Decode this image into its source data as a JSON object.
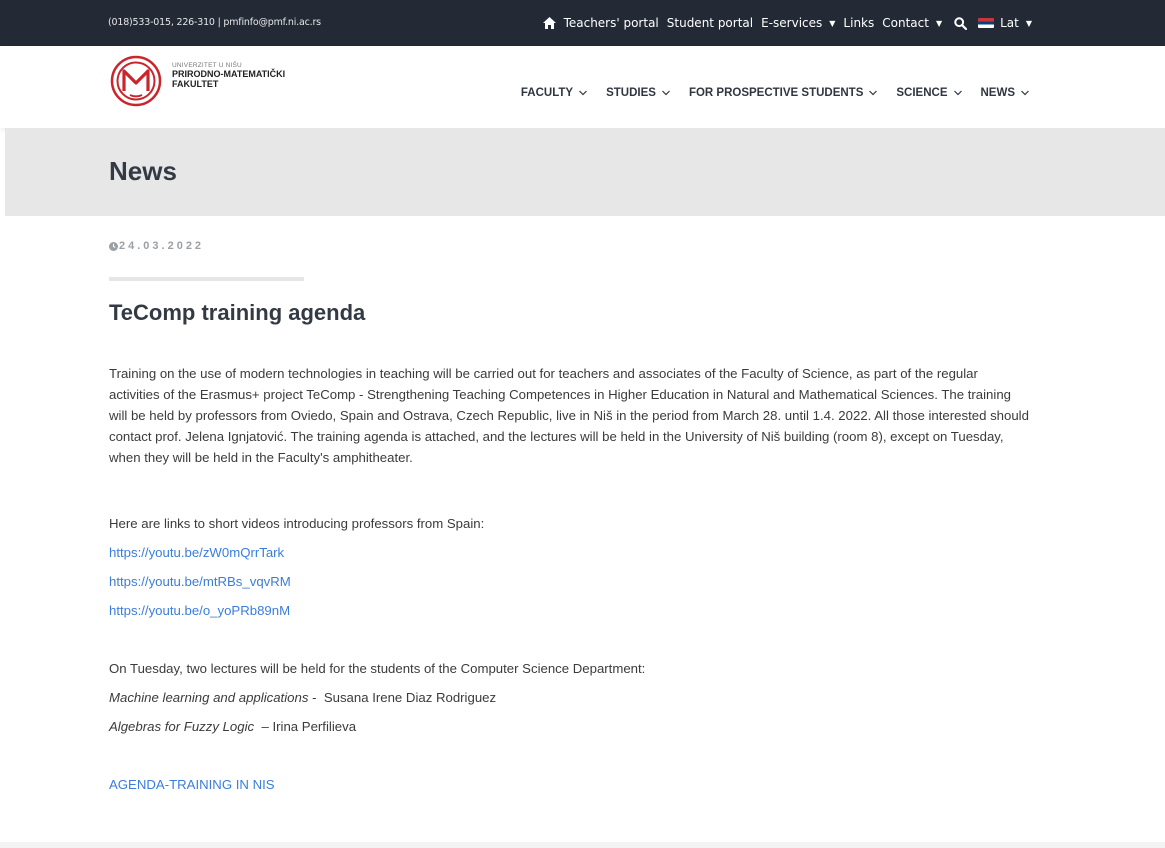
{
  "topbar": {
    "contact": "(018)533-015, 226-310 | pmfinfo@pmf.ni.ac.rs",
    "nav": {
      "teachers_portal": "Teachers' portal",
      "student_portal": "Student portal",
      "e_services": "E-services",
      "links": "Links",
      "contact": "Contact",
      "language": "Lat"
    }
  },
  "logo": {
    "line1": "UNIVERZITET U NIŠU",
    "line2": "PRIRODNO-MATEMATIČKI",
    "line3": "FAKULTET",
    "brand_color": "#c8262c"
  },
  "mainnav": {
    "faculty": "FACULTY",
    "studies": "STUDIES",
    "prospective": "FOR PROSPECTIVE STUDENTS",
    "science": "SCIENCE",
    "news": "NEWS"
  },
  "page_title": "News",
  "article": {
    "date": "24.03.2022",
    "title": "TeComp training agenda",
    "intro": "Training on the use of modern technologies in teaching will be carried out for teachers and associates of the Faculty of Science, as part of the regular activities of the Erasmus+ project TeComp - Strengthening Teaching Competences in Higher Education in Natural and Mathematical Sciences. The training will be held by professors from Oviedo, Spain and Ostrava, Czech Republic, live in Niš in the period from March 28. until 1.4. 2022. All those interested should contact prof. Jelena Ignjatović. The training agenda is attached, and the lectures will be held in the University of Niš building (room 8), except on Tuesday, when they will be held in the Faculty's amphitheater.",
    "videos_intro": "Here are links to short videos introducing professors from Spain:",
    "video_links": [
      "https://youtu.be/zW0mQrrTark",
      "https://youtu.be/mtRBs_vqvRM",
      "https://youtu.be/o_yoPRb89nM"
    ],
    "tuesday_intro": "On Tuesday, two lectures will be held for the students of the Computer Science Department:",
    "lecture1_title": "Machine learning and applications",
    "lecture1_sep": " -  ",
    "lecture1_author": "Susana Irene Diaz Rodriguez",
    "lecture2_title": "Algebras for Fuzzy Logic",
    "lecture2_sep": "  – ",
    "lecture2_author": "Irina Perfilieva",
    "agenda_link": "AGENDA-TRAINING IN NIS"
  },
  "colors": {
    "topbar_bg": "#232a35",
    "title_band_bg": "#e7e7e7",
    "link": "#3b7ddd"
  }
}
